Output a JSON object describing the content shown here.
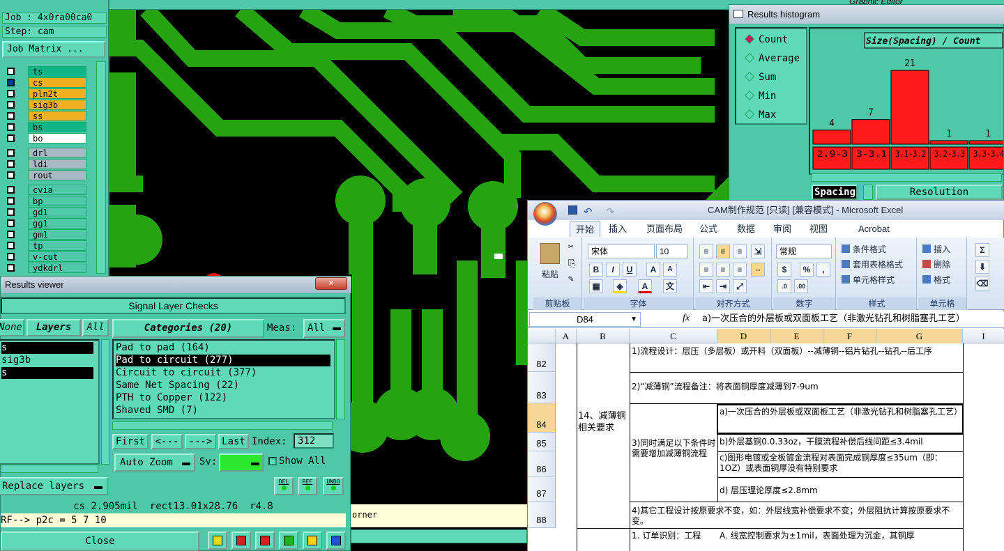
{
  "left_panel": {
    "job": "Job : 4x0ra00ca0",
    "step": "Step: cam",
    "job_matrix": "Job Matrix ...",
    "layers_group1": [
      {
        "name": "ts",
        "color": "#12b58a",
        "selected": false,
        "marks": ""
      },
      {
        "name": "cs",
        "color": "#f0b020",
        "selected": true,
        "marks": "✍⊞"
      },
      {
        "name": "pln2t",
        "color": "#f0b020",
        "selected": false,
        "marks": ""
      },
      {
        "name": "sig3b",
        "color": "#f0b020",
        "selected": false,
        "marks": "✍"
      },
      {
        "name": "ss",
        "color": "#f0b020",
        "selected": false,
        "marks": "✍"
      },
      {
        "name": "bs",
        "color": "#12b58a",
        "selected": false,
        "marks": ""
      },
      {
        "name": "bo",
        "color": "#ffffff",
        "selected": false,
        "marks": ""
      }
    ],
    "layers_group2": [
      {
        "name": "drl",
        "color": "#a9b8c2"
      },
      {
        "name": "ldi",
        "color": "#a9b8c2"
      },
      {
        "name": "rout",
        "color": "#a9b8c2"
      }
    ],
    "layers_group3": [
      {
        "name": "cvia",
        "marks": ""
      },
      {
        "name": "bp",
        "marks": ""
      },
      {
        "name": "gd1",
        "marks": "✍"
      },
      {
        "name": "gg1",
        "marks": ""
      },
      {
        "name": "gm1",
        "marks": ""
      },
      {
        "name": "tp",
        "marks": ""
      },
      {
        "name": "v-cut",
        "marks": ""
      },
      {
        "name": "ydkdrl",
        "marks": ""
      }
    ]
  },
  "results_viewer": {
    "title": "Results viewer",
    "close_x": "✕",
    "header": "Signal Layer Checks",
    "tab_none": "None",
    "tab_layers": "Layers",
    "tab_all": "All",
    "layer_items": [
      "s",
      "sig3b",
      "s"
    ],
    "categories_label": "Categories (20)",
    "meas_label": "Meas:",
    "meas_value": "All",
    "categories": [
      "Pad to pad (164)",
      "Pad to circuit (277)",
      "Circuit to circuit (377)",
      "Same Net Spacing (22)",
      "PTH to Copper (122)",
      "Shaved SMD (7)"
    ],
    "nav_first": "First",
    "nav_prev": "<---",
    "nav_next": "--->",
    "nav_last": "Last",
    "index_label": "Index:",
    "index_value": "312",
    "auto_zoom": "Auto Zoom",
    "sv_label": "Sv:",
    "show_all": "Show All",
    "replace_layers": "Replace layers",
    "tool_del": "DEL",
    "tool_ref": "REF",
    "tool_undo": "UNDO",
    "status_line": "cs 2.905mil  rect13.01x28.76  r4.8",
    "ref_line": "RF--> p2c = 5 7 10",
    "close": "Close",
    "corner_text": "orner"
  },
  "histogram": {
    "title": "Results histogram",
    "top_title": "Graphic Editor",
    "radios": [
      {
        "label": "Count",
        "on": true
      },
      {
        "label": "Average",
        "on": false
      },
      {
        "label": "Sum",
        "on": false
      },
      {
        "label": "Min",
        "on": false
      },
      {
        "label": "Max",
        "on": false
      }
    ],
    "chart_title": "Size(Spacing) / Count",
    "spacing_label": "Spacing",
    "resolution_label": "Resolution"
  },
  "chart_data": {
    "type": "bar",
    "title": "Size(Spacing) / Count",
    "categories": [
      "2.9-3",
      "3-3.1",
      "3.1-3.2",
      "3.2-3.3",
      "3.3-3.4"
    ],
    "values": [
      4,
      7,
      21,
      1,
      1
    ],
    "ylim": [
      0,
      23
    ],
    "bar_color": "#ff1a1a"
  },
  "excel": {
    "title": "CAM制作规范  [只读]  [兼容模式] - Microsoft Excel",
    "tabs": [
      "开始",
      "插入",
      "页面布局",
      "公式",
      "数据",
      "审阅",
      "视图",
      "Acrobat"
    ],
    "clipboard_group": "剪贴板",
    "paste": "粘贴",
    "font_group": "字体",
    "font_name": "宋体",
    "font_size": "10",
    "align_group": "对齐方式",
    "number_group": "数字",
    "number_format": "常规",
    "style_group": "样式",
    "cond_format": "条件格式",
    "table_format": "套用表格格式",
    "cell_style": "单元格样式",
    "cells_group": "单元格",
    "insert": "插入",
    "delete": "删除",
    "format": "格式",
    "cell_ref": "D84",
    "fx": "fx",
    "formula_value": "a)一次压合的外层板或双面板工艺（非激光钻孔和树脂塞孔工艺）",
    "columns": [
      "A",
      "B",
      "C",
      "D",
      "E",
      "F",
      "G",
      "I"
    ],
    "rows": [
      "82",
      "83",
      "84",
      "85",
      "86",
      "87",
      "88"
    ],
    "b_cell": "14、减薄铜相关要求",
    "c82": "1)流程设计：层压（多层板）或开料（双面板）--减薄铜--铝片钻孔--钻孔--后工序",
    "c83": "2)“减薄铜”流程备注：将表面铜厚度减薄到7-9um",
    "c84": "3)同时满足以下条件时需要增加减薄铜流程",
    "d84": "a)一次压合的外层板或双面板工艺（非激光钻孔和树脂塞孔工艺）",
    "d85": "b)外层基铜0.0.33oz，干膜流程补偿后线间距≤3.4mil",
    "d86": "c)图形电镀或全板镀金流程对表面完成铜厚度≤35um（即：1OZ）或表面铜厚没有特别要求",
    "d87": "d) 层压理论厚度≤2.8mm",
    "c88": "4)其它工程设计按原要求不变，如：外层线宽补偿要求不变；外层阻抗计算按原要求不变。",
    "c89": "1. 订单识别：工程",
    "d89": "A. 线宽控制要求为±1mil，表面处理为沉金，其铜厚"
  }
}
